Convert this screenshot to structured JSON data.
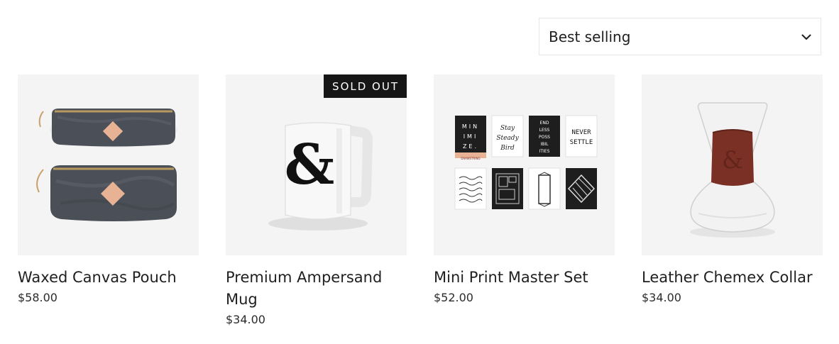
{
  "sort": {
    "selected": "Best selling",
    "icon": "chevron-down-icon"
  },
  "products": [
    {
      "title": "Waxed Canvas Pouch",
      "price": "$58.00",
      "badge": ""
    },
    {
      "title": "Premium Ampersand Mug",
      "price": "$34.00",
      "badge": "SOLD OUT"
    },
    {
      "title": "Mini Print Master Set",
      "price": "$52.00",
      "badge": ""
    },
    {
      "title": "Leather Chemex Collar",
      "price": "$34.00",
      "badge": ""
    }
  ],
  "print_cards": {
    "minimize": [
      "MIN",
      "IMI",
      "ZE."
    ],
    "stay_lines": [
      "Stay",
      "Steady",
      "Bird"
    ],
    "endless": [
      "END",
      "LESS",
      "POSS",
      "IBIL",
      "ITIES"
    ],
    "never": [
      "NEVER",
      "SETTLE"
    ],
    "minimize_tag": "DRAWSTRING"
  },
  "colors": {
    "image_bg": "#f4f4f4",
    "badge_bg": "#161616",
    "canvas_grey": "#4b4f57",
    "leather": "#7a3024",
    "tag_pink": "#e8b394"
  }
}
